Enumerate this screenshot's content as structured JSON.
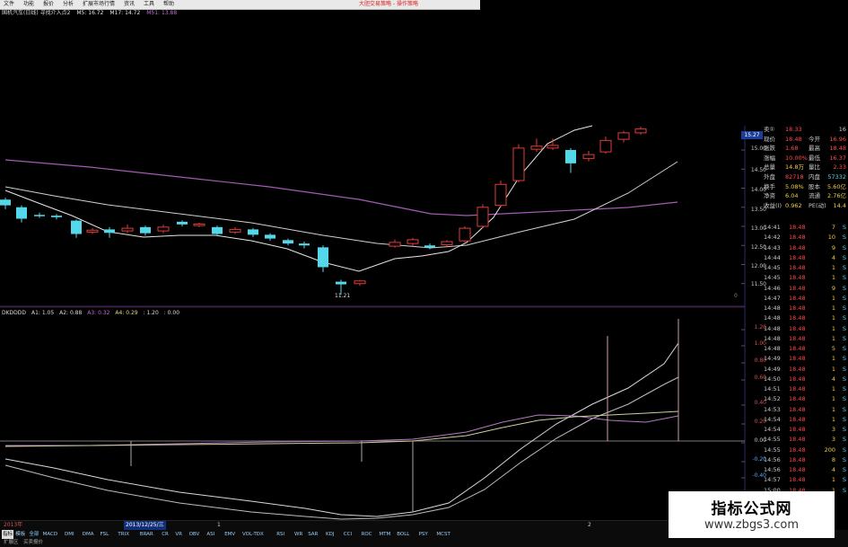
{
  "menu": {
    "items": [
      "文件",
      "功能",
      "报价",
      "分析",
      "扩展市场行情",
      "资讯",
      "工具",
      "帮助"
    ],
    "right_text": "大胆交易策略 - 操作策略"
  },
  "ma_header": {
    "name": "国机汽车(日线) 寻找介入点2",
    "ma5": "M5: 16.72",
    "ma17": "M17: 14.72",
    "ma51": "M51: 13.88"
  },
  "kdj_header": {
    "name": "DKDDDD",
    "a1": "A1: 1.05",
    "a2": "A2: 0.88",
    "a3": "A3: 0.32",
    "a4": "A4: 0.29",
    "v5": ": 1.20",
    "v6": ": 0.00"
  },
  "price_axis": [
    "15.00",
    "14.50",
    "14.00",
    "13.50",
    "13.00",
    "12.50",
    "12.00",
    "11.50"
  ],
  "current_price_tag": "15.27",
  "low_label": "11.21",
  "zero_mark": "0",
  "ind_axis": [
    "1.20",
    "1.00",
    "0.80",
    "0.60",
    "0.40",
    "0.20",
    "0.00",
    "-0.20",
    "-0.40"
  ],
  "quote": [
    {
      "l": "卖①",
      "v": "18.33",
      "r": "",
      "rv": "16"
    },
    {
      "l": "现价",
      "v": "18.48",
      "r": "今开",
      "rv": "16.96"
    },
    {
      "l": "涨跌",
      "v": "1.68",
      "r": "最高",
      "rv": "18.48"
    },
    {
      "l": "涨幅",
      "v": "10.00%",
      "r": "最低",
      "rv": "16.37"
    },
    {
      "l": "总量",
      "v": "14.8万",
      "r": "量比",
      "rv": "2.33"
    },
    {
      "l": "外盘",
      "v": "82718",
      "r": "内盘",
      "rv": "57332"
    },
    {
      "l": "换手",
      "v": "5.08%",
      "r": "股本",
      "rv": "5.60亿"
    },
    {
      "l": "净资",
      "v": "6.04",
      "r": "流通",
      "rv": "2.76亿"
    },
    {
      "l": "收益(I)",
      "v": "0.962",
      "r": "PE(动)",
      "rv": "14.4"
    }
  ],
  "ticks": [
    {
      "t": "14:41",
      "p": "18.48",
      "v": "7",
      "s": "S"
    },
    {
      "t": "14:42",
      "p": "18.48",
      "v": "10",
      "s": "S"
    },
    {
      "t": "14:43",
      "p": "18.48",
      "v": "9",
      "s": "S"
    },
    {
      "t": "14:44",
      "p": "18.48",
      "v": "4",
      "s": "S"
    },
    {
      "t": "14:45",
      "p": "18.48",
      "v": "1",
      "s": "S"
    },
    {
      "t": "14:45",
      "p": "18.48",
      "v": "1",
      "s": "S"
    },
    {
      "t": "14:46",
      "p": "18.48",
      "v": "9",
      "s": "S"
    },
    {
      "t": "14:47",
      "p": "18.48",
      "v": "1",
      "s": "S"
    },
    {
      "t": "14:48",
      "p": "18.48",
      "v": "1",
      "s": "S"
    },
    {
      "t": "14:48",
      "p": "18.48",
      "v": "1",
      "s": "S"
    },
    {
      "t": "14:48",
      "p": "18.48",
      "v": "1",
      "s": "S"
    },
    {
      "t": "14:48",
      "p": "18.48",
      "v": "1",
      "s": "S"
    },
    {
      "t": "14:48",
      "p": "18.48",
      "v": "5",
      "s": "S"
    },
    {
      "t": "14:49",
      "p": "18.48",
      "v": "1",
      "s": "S"
    },
    {
      "t": "14:49",
      "p": "18.48",
      "v": "1",
      "s": "S"
    },
    {
      "t": "14:50",
      "p": "18.48",
      "v": "4",
      "s": "S"
    },
    {
      "t": "14:51",
      "p": "18.48",
      "v": "1",
      "s": "S"
    },
    {
      "t": "14:52",
      "p": "18.48",
      "v": "1",
      "s": "S"
    },
    {
      "t": "14:53",
      "p": "18.48",
      "v": "1",
      "s": "S"
    },
    {
      "t": "14:54",
      "p": "18.48",
      "v": "1",
      "s": "S"
    },
    {
      "t": "14:54",
      "p": "18.48",
      "v": "3",
      "s": "S"
    },
    {
      "t": "14:55",
      "p": "18.48",
      "v": "3",
      "s": "S"
    },
    {
      "t": "14:55",
      "p": "18.48",
      "v": "200",
      "s": "S"
    },
    {
      "t": "14:56",
      "p": "18.48",
      "v": "8",
      "s": "S"
    },
    {
      "t": "14:56",
      "p": "18.48",
      "v": "4",
      "s": "S"
    },
    {
      "t": "14:57",
      "p": "18.48",
      "v": "1",
      "s": "S"
    },
    {
      "t": "15:00",
      "p": "18.48",
      "v": "1",
      "s": "S"
    }
  ],
  "date_bar": {
    "left": "2013年",
    "highlight": "2013/12/25/三",
    "mid": "1",
    "right": "2"
  },
  "tabs": [
    "指标",
    "模板",
    "全部",
    "MACD",
    "DMI",
    "DMA",
    "FSL",
    "TRIX",
    "BRAR",
    "CR",
    "VR",
    "OBV",
    "ASI",
    "EMV",
    "VOL-TDX",
    "RSI",
    "WR",
    "SAR",
    "KDJ",
    "CCI",
    "ROC",
    "MTM",
    "BOLL",
    "PSY",
    "MCST"
  ],
  "bottom_labels": [
    "扩展区",
    "买卖报价"
  ],
  "watermark": {
    "title": "指标公式网",
    "url": "www.zbgs3.com"
  },
  "colors": {
    "up": "#e23b3b",
    "down": "#54d7e8",
    "ma_white": "#d8d8d8",
    "ma_purple": "#a45bb3",
    "axis": "#2b2b74"
  }
}
